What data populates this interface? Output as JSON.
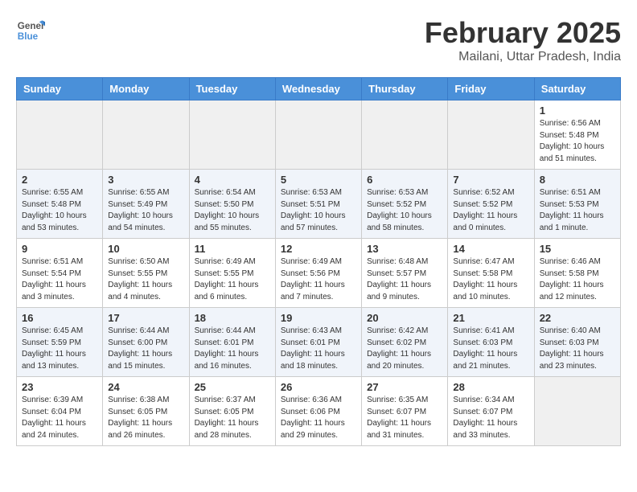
{
  "header": {
    "logo_line1": "General",
    "logo_line2": "Blue",
    "title": "February 2025",
    "subtitle": "Mailani, Uttar Pradesh, India"
  },
  "weekdays": [
    "Sunday",
    "Monday",
    "Tuesday",
    "Wednesday",
    "Thursday",
    "Friday",
    "Saturday"
  ],
  "weeks": [
    [
      {
        "day": "",
        "info": ""
      },
      {
        "day": "",
        "info": ""
      },
      {
        "day": "",
        "info": ""
      },
      {
        "day": "",
        "info": ""
      },
      {
        "day": "",
        "info": ""
      },
      {
        "day": "",
        "info": ""
      },
      {
        "day": "1",
        "info": "Sunrise: 6:56 AM\nSunset: 5:48 PM\nDaylight: 10 hours\nand 51 minutes."
      }
    ],
    [
      {
        "day": "2",
        "info": "Sunrise: 6:55 AM\nSunset: 5:48 PM\nDaylight: 10 hours\nand 53 minutes."
      },
      {
        "day": "3",
        "info": "Sunrise: 6:55 AM\nSunset: 5:49 PM\nDaylight: 10 hours\nand 54 minutes."
      },
      {
        "day": "4",
        "info": "Sunrise: 6:54 AM\nSunset: 5:50 PM\nDaylight: 10 hours\nand 55 minutes."
      },
      {
        "day": "5",
        "info": "Sunrise: 6:53 AM\nSunset: 5:51 PM\nDaylight: 10 hours\nand 57 minutes."
      },
      {
        "day": "6",
        "info": "Sunrise: 6:53 AM\nSunset: 5:52 PM\nDaylight: 10 hours\nand 58 minutes."
      },
      {
        "day": "7",
        "info": "Sunrise: 6:52 AM\nSunset: 5:52 PM\nDaylight: 11 hours\nand 0 minutes."
      },
      {
        "day": "8",
        "info": "Sunrise: 6:51 AM\nSunset: 5:53 PM\nDaylight: 11 hours\nand 1 minute."
      }
    ],
    [
      {
        "day": "9",
        "info": "Sunrise: 6:51 AM\nSunset: 5:54 PM\nDaylight: 11 hours\nand 3 minutes."
      },
      {
        "day": "10",
        "info": "Sunrise: 6:50 AM\nSunset: 5:55 PM\nDaylight: 11 hours\nand 4 minutes."
      },
      {
        "day": "11",
        "info": "Sunrise: 6:49 AM\nSunset: 5:55 PM\nDaylight: 11 hours\nand 6 minutes."
      },
      {
        "day": "12",
        "info": "Sunrise: 6:49 AM\nSunset: 5:56 PM\nDaylight: 11 hours\nand 7 minutes."
      },
      {
        "day": "13",
        "info": "Sunrise: 6:48 AM\nSunset: 5:57 PM\nDaylight: 11 hours\nand 9 minutes."
      },
      {
        "day": "14",
        "info": "Sunrise: 6:47 AM\nSunset: 5:58 PM\nDaylight: 11 hours\nand 10 minutes."
      },
      {
        "day": "15",
        "info": "Sunrise: 6:46 AM\nSunset: 5:58 PM\nDaylight: 11 hours\nand 12 minutes."
      }
    ],
    [
      {
        "day": "16",
        "info": "Sunrise: 6:45 AM\nSunset: 5:59 PM\nDaylight: 11 hours\nand 13 minutes."
      },
      {
        "day": "17",
        "info": "Sunrise: 6:44 AM\nSunset: 6:00 PM\nDaylight: 11 hours\nand 15 minutes."
      },
      {
        "day": "18",
        "info": "Sunrise: 6:44 AM\nSunset: 6:01 PM\nDaylight: 11 hours\nand 16 minutes."
      },
      {
        "day": "19",
        "info": "Sunrise: 6:43 AM\nSunset: 6:01 PM\nDaylight: 11 hours\nand 18 minutes."
      },
      {
        "day": "20",
        "info": "Sunrise: 6:42 AM\nSunset: 6:02 PM\nDaylight: 11 hours\nand 20 minutes."
      },
      {
        "day": "21",
        "info": "Sunrise: 6:41 AM\nSunset: 6:03 PM\nDaylight: 11 hours\nand 21 minutes."
      },
      {
        "day": "22",
        "info": "Sunrise: 6:40 AM\nSunset: 6:03 PM\nDaylight: 11 hours\nand 23 minutes."
      }
    ],
    [
      {
        "day": "23",
        "info": "Sunrise: 6:39 AM\nSunset: 6:04 PM\nDaylight: 11 hours\nand 24 minutes."
      },
      {
        "day": "24",
        "info": "Sunrise: 6:38 AM\nSunset: 6:05 PM\nDaylight: 11 hours\nand 26 minutes."
      },
      {
        "day": "25",
        "info": "Sunrise: 6:37 AM\nSunset: 6:05 PM\nDaylight: 11 hours\nand 28 minutes."
      },
      {
        "day": "26",
        "info": "Sunrise: 6:36 AM\nSunset: 6:06 PM\nDaylight: 11 hours\nand 29 minutes."
      },
      {
        "day": "27",
        "info": "Sunrise: 6:35 AM\nSunset: 6:07 PM\nDaylight: 11 hours\nand 31 minutes."
      },
      {
        "day": "28",
        "info": "Sunrise: 6:34 AM\nSunset: 6:07 PM\nDaylight: 11 hours\nand 33 minutes."
      },
      {
        "day": "",
        "info": ""
      }
    ]
  ]
}
